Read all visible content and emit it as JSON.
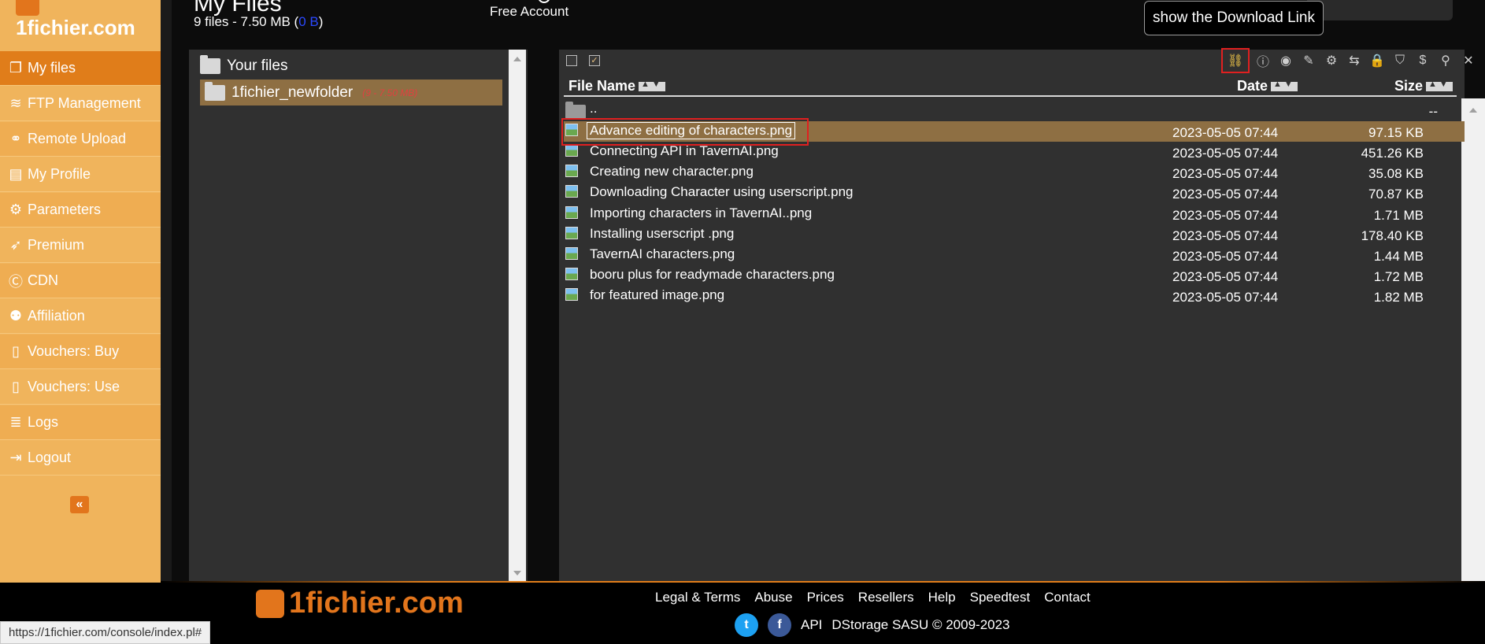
{
  "brand": {
    "logo_text": "1fichier.com"
  },
  "sidebar": {
    "items": [
      {
        "label": "My files",
        "icon": "files-icon",
        "glyph": "❐"
      },
      {
        "label": "FTP Management",
        "icon": "wifi-icon",
        "glyph": "≋"
      },
      {
        "label": "Remote Upload",
        "icon": "link-icon",
        "glyph": "⚭"
      },
      {
        "label": "My Profile",
        "icon": "profile-icon",
        "glyph": "▤"
      },
      {
        "label": "Parameters",
        "icon": "gears-icon",
        "glyph": "⚙"
      },
      {
        "label": "Premium",
        "icon": "rocket-icon",
        "glyph": "➶"
      },
      {
        "label": "CDN",
        "icon": "cdn-icon",
        "glyph": "Ⓒ"
      },
      {
        "label": "Affiliation",
        "icon": "users-icon",
        "glyph": "⚉"
      },
      {
        "label": "Vouchers: Buy",
        "icon": "voucher-buy-icon",
        "glyph": "▯"
      },
      {
        "label": "Vouchers: Use",
        "icon": "voucher-use-icon",
        "glyph": "▯"
      },
      {
        "label": "Logs",
        "icon": "logs-icon",
        "glyph": "≣"
      },
      {
        "label": "Logout",
        "icon": "logout-icon",
        "glyph": "⇥"
      }
    ],
    "collapse_glyph": "«"
  },
  "header": {
    "title": "My Files",
    "stats_prefix": "9 files - 7.50 MB (",
    "stats_blue": "0 B",
    "stats_suffix": ")",
    "account": "Free Account",
    "tooltip": "show the Download Link"
  },
  "folders": {
    "root_label": "Your files",
    "items": [
      {
        "name": "1fichier_newfolder",
        "meta": "(9 - 7.50 MB)"
      }
    ]
  },
  "toolbar": {
    "tools": [
      "link-icon",
      "info-icon",
      "eye-icon",
      "edit-icon",
      "settings-icon",
      "move-icon",
      "lock-icon",
      "shield-icon",
      "dollar-icon",
      "pin-icon",
      "delete-icon"
    ],
    "glyphs": [
      "⛓",
      "ⓘ",
      "◉",
      "✎",
      "⚙",
      "⇆",
      "🔒",
      "⛉",
      "$",
      "⚲",
      "✕"
    ]
  },
  "columns": {
    "name": "File Name",
    "date": "Date",
    "size": "Size"
  },
  "parent": {
    "name": "..",
    "size": "--"
  },
  "files": [
    {
      "name": "Advance editing of characters.png",
      "date": "2023-05-05 07:44",
      "size": "97.15 KB"
    },
    {
      "name": "Connecting API in TavernAI.png",
      "date": "2023-05-05 07:44",
      "size": "451.26 KB"
    },
    {
      "name": "Creating new character.png",
      "date": "2023-05-05 07:44",
      "size": "35.08 KB"
    },
    {
      "name": "Downloading Character using userscript.png",
      "date": "2023-05-05 07:44",
      "size": "70.87 KB"
    },
    {
      "name": "Importing characters in TavernAI..png",
      "date": "2023-05-05 07:44",
      "size": "1.71 MB"
    },
    {
      "name": "Installing userscript .png",
      "date": "2023-05-05 07:44",
      "size": "178.40 KB"
    },
    {
      "name": "TavernAI characters.png",
      "date": "2023-05-05 07:44",
      "size": "1.44 MB"
    },
    {
      "name": "booru plus for readymade characters.png",
      "date": "2023-05-05 07:44",
      "size": "1.72 MB"
    },
    {
      "name": "for featured image.png",
      "date": "2023-05-05 07:44",
      "size": "1.82 MB"
    }
  ],
  "footer": {
    "links": [
      "Legal & Terms",
      "Abuse",
      "Prices",
      "Resellers",
      "Help",
      "Speedtest",
      "Contact"
    ],
    "api": "API",
    "copyright": "DStorage SASU © 2009-2023"
  },
  "status_url": "https://1fichier.com/console/index.pl#",
  "colors": {
    "sidebar": "#f0b45c",
    "active": "#e07d1a",
    "selected_row": "#8e6f43",
    "panel": "#303030",
    "highlight_box": "#e02020"
  }
}
